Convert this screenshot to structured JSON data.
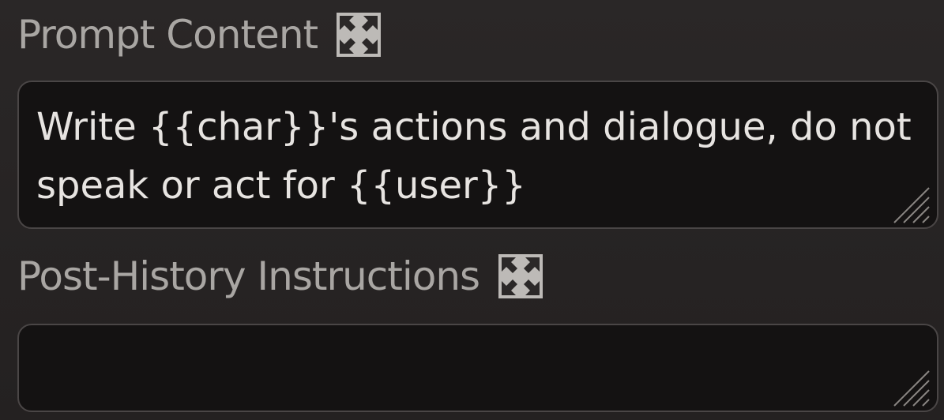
{
  "prompt_content": {
    "label": "Prompt Content",
    "icon": "expand-icon",
    "value": "Write {{char}}'s actions and dialogue, do not speak or act for {{user}}"
  },
  "post_history": {
    "label": "Post-History Instructions",
    "icon": "expand-icon",
    "value": ""
  },
  "colors": {
    "background": "#272424",
    "field_background": "#141212",
    "label_text": "#a9a6a3",
    "field_text": "#e7e4e1",
    "border": "#4a4646"
  }
}
